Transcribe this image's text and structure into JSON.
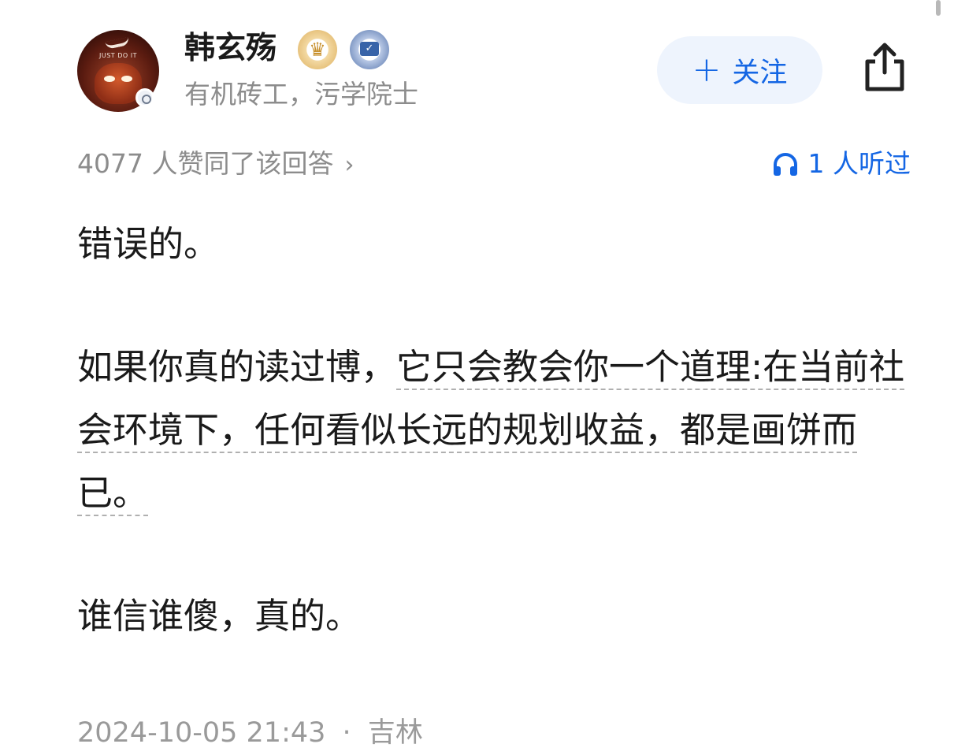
{
  "author": {
    "name": "韩玄殇",
    "bio": "有机砖工，污学院士",
    "avatar_text": "JUST DO IT",
    "avatar_icon": "nike-avatar-icon",
    "badges": [
      "crown-badge-icon",
      "certified-badge-icon"
    ]
  },
  "actions": {
    "follow_label": "关注",
    "follow_icon": "plus-icon",
    "share_icon": "share-icon"
  },
  "stats": {
    "votes_text": "4077 人赞同了该回答",
    "listen_text": "1 人听过",
    "listen_icon": "headphones-icon"
  },
  "content": {
    "paragraph_1": "错误的。",
    "paragraph_2_plain": "如果你真的读过博，",
    "paragraph_2_underlined": "它只会教会你一个道理:在当前社会环境下，任何看似长远的规划收益，都是画饼而已。",
    "paragraph_3": "谁信谁傻，真的。"
  },
  "meta": {
    "datetime": "2024-10-05 21:43",
    "separator": "·",
    "location": "吉林"
  },
  "colors": {
    "accent_blue": "#1466e4",
    "follow_bg": "#eef4fd",
    "muted_gray": "#8c8c8c",
    "text_primary": "#1a1a1a"
  }
}
